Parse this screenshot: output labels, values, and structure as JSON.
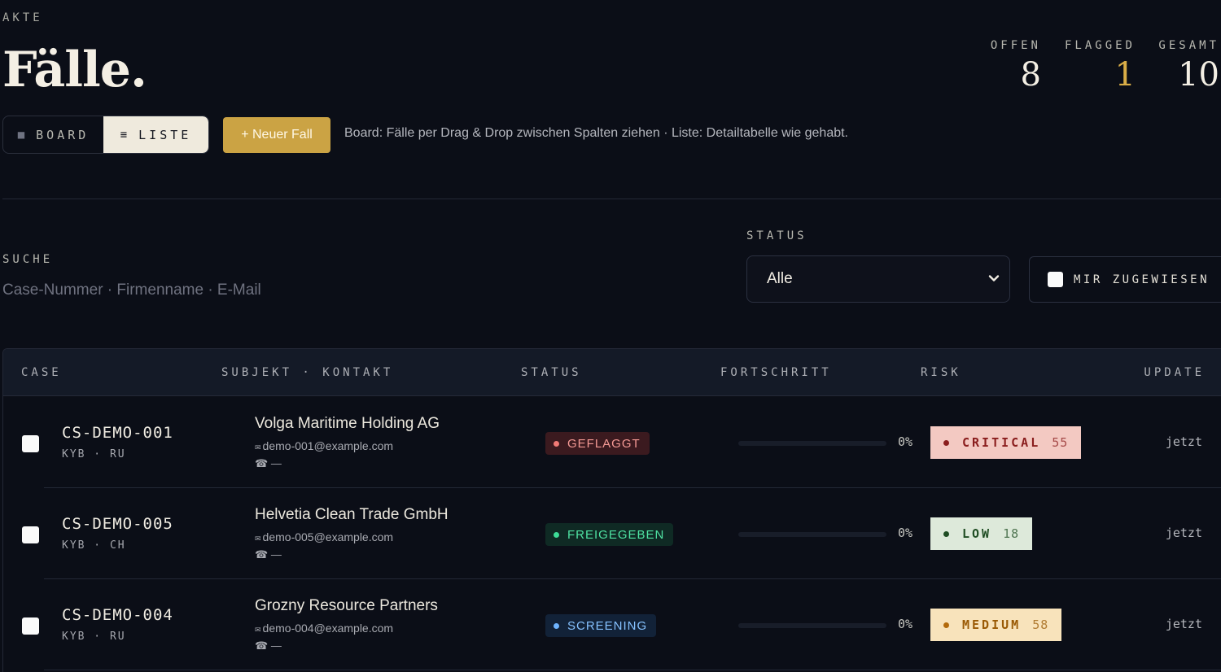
{
  "header": {
    "eyebrow": "AKTE",
    "title": "Fälle."
  },
  "stats": [
    {
      "label": "OFFEN",
      "value": "8"
    },
    {
      "label": "FLAGGED",
      "value": "1"
    },
    {
      "label": "GESAMT",
      "value": "10"
    }
  ],
  "view_toggle": {
    "board_label": "BOARD",
    "liste_label": "LISTE",
    "board_icon": "grid-square-icon",
    "liste_icon": "list-icon",
    "active": "LISTE"
  },
  "new_case_label": "+ Neuer Fall",
  "hint_text": "Board: Fälle per Drag & Drop zwischen Spalten ziehen · Liste: Detailtabelle wie gehabt.",
  "filters": {
    "search_label": "SUCHE",
    "search_placeholder": "Case-Nummer · Firmenname · E-Mail",
    "search_value": "",
    "status_label": "STATUS",
    "status_value": "Alle",
    "assigned_label": "MIR ZUGEWIESEN",
    "assigned_checked": false
  },
  "table": {
    "columns": [
      "CASE",
      "SUBJEKT · KONTAKT",
      "STATUS",
      "FORTSCHRITT",
      "RISK",
      "UPDATE"
    ],
    "rows": [
      {
        "case_id": "CS-DEMO-001",
        "case_meta": "KYB · RU",
        "subject": "Volga Maritime Holding AG",
        "email": "demo-001@example.com",
        "phone": "—",
        "status": "GEFLAGGT",
        "progress": 0,
        "progress_label": "0%",
        "risk_level": "CRITICAL",
        "risk_score": "55",
        "updated": "jetzt"
      },
      {
        "case_id": "CS-DEMO-005",
        "case_meta": "KYB · CH",
        "subject": "Helvetia Clean Trade GmbH",
        "email": "demo-005@example.com",
        "phone": "—",
        "status": "FREIGEGEBEN",
        "progress": 0,
        "progress_label": "0%",
        "risk_level": "LOW",
        "risk_score": "18",
        "updated": "jetzt"
      },
      {
        "case_id": "CS-DEMO-004",
        "case_meta": "KYB · RU",
        "subject": "Grozny Resource Partners",
        "email": "demo-004@example.com",
        "phone": "—",
        "status": "SCREENING",
        "progress": 0,
        "progress_label": "0%",
        "risk_level": "MEDIUM",
        "risk_score": "58",
        "updated": "jetzt"
      }
    ]
  },
  "colors": {
    "background": "#0b0e17",
    "accent_gold": "#cba344",
    "status_geflaggt": "#f27a76",
    "status_freigegeben": "#3ddc97",
    "status_screening": "#6fb4ff",
    "risk_critical_bg": "#f3c9c2",
    "risk_low_bg": "#dde9da",
    "risk_medium_bg": "#f8e3bb"
  }
}
